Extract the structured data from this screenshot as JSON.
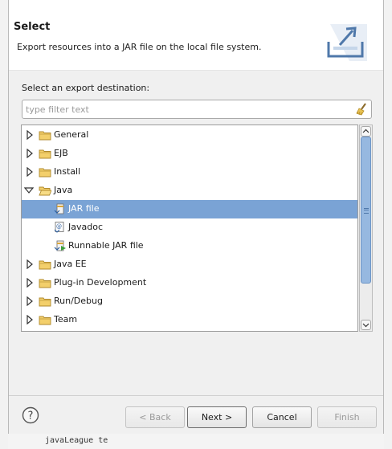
{
  "header": {
    "title": "Select",
    "description": "Export resources into a JAR file on the local file system."
  },
  "destination_label": "Select an export destination:",
  "filter": {
    "placeholder": "type filter text",
    "value": ""
  },
  "tree": {
    "items": [
      {
        "label": "General",
        "expanded": false,
        "level": 0,
        "icon": "folder-icon"
      },
      {
        "label": "EJB",
        "expanded": false,
        "level": 0,
        "icon": "folder-icon"
      },
      {
        "label": "Install",
        "expanded": false,
        "level": 0,
        "icon": "folder-icon"
      },
      {
        "label": "Java",
        "expanded": true,
        "level": 0,
        "icon": "folder-open-icon"
      },
      {
        "label": "JAR file",
        "level": 1,
        "icon": "jar-file-icon",
        "selected": true
      },
      {
        "label": "Javadoc",
        "level": 1,
        "icon": "javadoc-icon"
      },
      {
        "label": "Runnable JAR file",
        "level": 1,
        "icon": "runnable-jar-icon"
      },
      {
        "label": "Java EE",
        "expanded": false,
        "level": 0,
        "icon": "folder-icon"
      },
      {
        "label": "Plug-in Development",
        "expanded": false,
        "level": 0,
        "icon": "folder-icon"
      },
      {
        "label": "Run/Debug",
        "expanded": false,
        "level": 0,
        "icon": "folder-icon"
      },
      {
        "label": "Team",
        "expanded": false,
        "level": 0,
        "icon": "folder-icon"
      }
    ]
  },
  "buttons": {
    "back": "< Back",
    "next": "Next >",
    "cancel": "Cancel",
    "finish": "Finish"
  },
  "background": {
    "bottom_snippet": "javaLeague te"
  },
  "colors": {
    "selection": "#7aa3d5",
    "dialog_bg": "#f0f0f0",
    "folder": "#e8b84a"
  }
}
